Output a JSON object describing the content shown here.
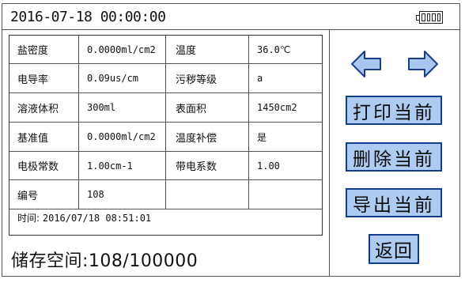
{
  "header": {
    "datetime": "2016-07-18  00:00:00",
    "battery_icon": "battery-icon"
  },
  "table": {
    "rows": [
      {
        "label1": "盐密度",
        "value1": "0.0000ml/cm2",
        "label2": "温度",
        "value2": "36.0℃"
      },
      {
        "label1": "电导率",
        "value1": "0.09us/cm",
        "label2": "污秽等级",
        "value2": "a"
      },
      {
        "label1": "溶液体积",
        "value1": "300ml",
        "label2": "表面积",
        "value2": "1450cm2"
      },
      {
        "label1": "基准值",
        "value1": "0.0000ml/cm2",
        "label2": "温度补偿",
        "value2": "是"
      },
      {
        "label1": "电极常数",
        "value1": "1.00cm-1",
        "label2": "带电系数",
        "value2": "1.00"
      },
      {
        "label1": "编号",
        "value1": "108",
        "label2": "",
        "value2": ""
      }
    ],
    "time_label": "时间:",
    "time_value": "2016/07/18 08:51:01"
  },
  "storage": {
    "text": "储存空间:108/100000"
  },
  "nav": {
    "prev_icon": "arrow-left-icon",
    "next_icon": "arrow-right-icon"
  },
  "buttons": {
    "print": "打印当前",
    "delete": "删除当前",
    "export": "导出当前",
    "back": "返回"
  },
  "colors": {
    "button_fill": "#aecbf1",
    "button_border": "#123d8c",
    "arrow_fill": "#a9c7ee",
    "arrow_stroke": "#1a3f86"
  }
}
